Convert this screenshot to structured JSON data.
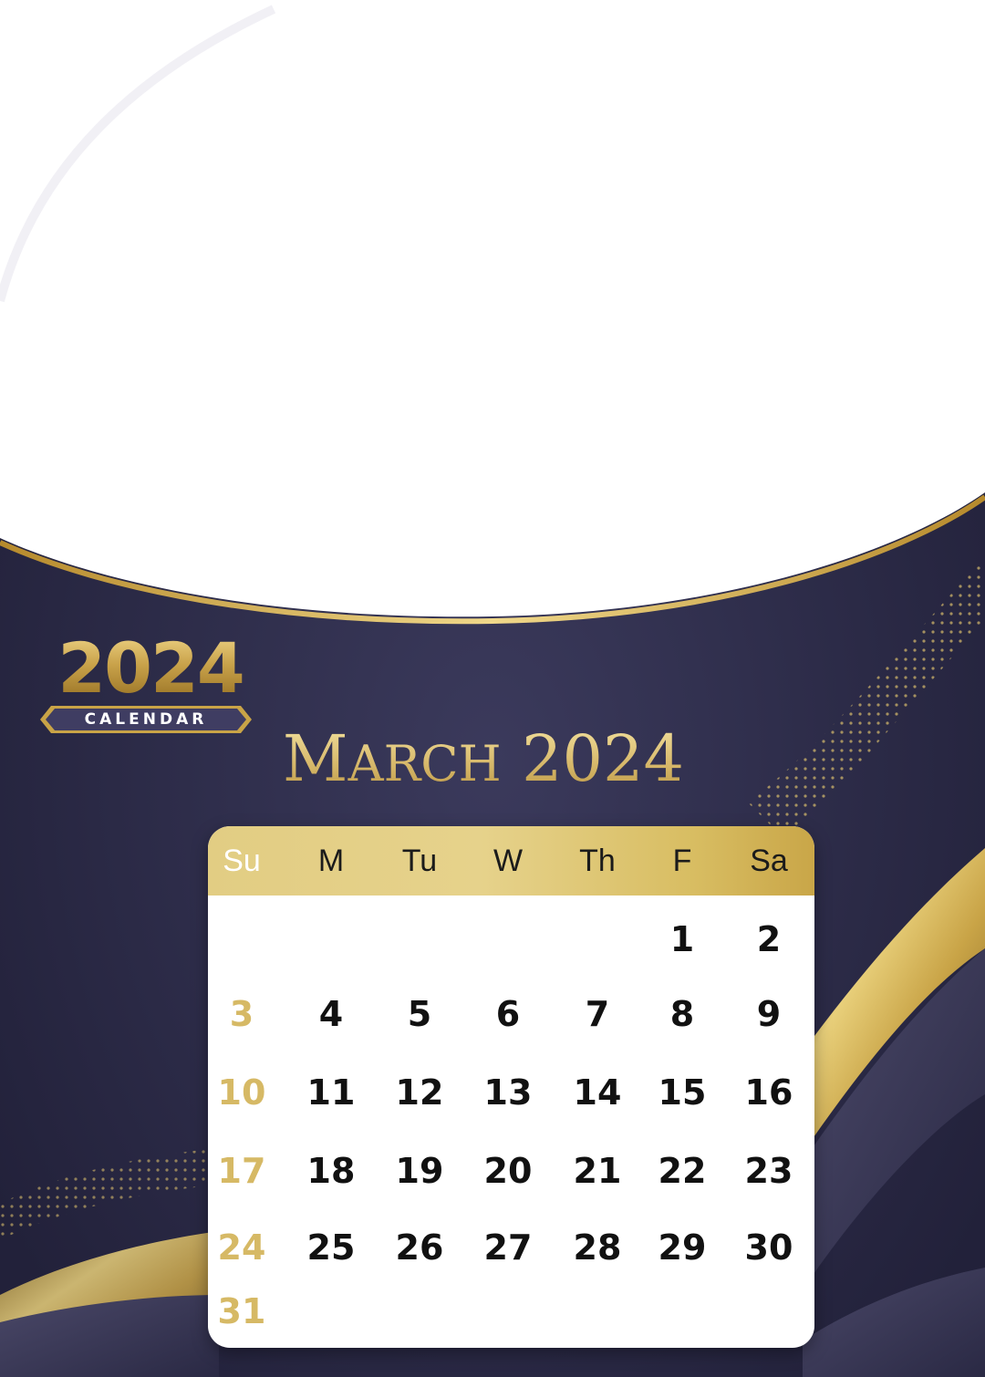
{
  "logo": {
    "year": "2024",
    "ribbon_label": "CALENDAR"
  },
  "title": {
    "month_first": "M",
    "month_rest": "ARCH",
    "year": "2024"
  },
  "weekdays": [
    "Su",
    "M",
    "Tu",
    "W",
    "Th",
    "F",
    "Sa"
  ],
  "weeks": [
    [
      "",
      "",
      "",
      "",
      "",
      "1",
      "2"
    ],
    [
      "3",
      "4",
      "5",
      "6",
      "7",
      "8",
      "9"
    ],
    [
      "10",
      "11",
      "12",
      "13",
      "14",
      "15",
      "16"
    ],
    [
      "17",
      "18",
      "19",
      "20",
      "21",
      "22",
      "23"
    ],
    [
      "24",
      "25",
      "26",
      "27",
      "28",
      "29",
      "30"
    ],
    [
      "31",
      "",
      "",
      "",
      "",
      "",
      ""
    ]
  ],
  "colors": {
    "navy": "#2e2d4c",
    "gold": "#d6b965",
    "header_gold": "#e2cd83",
    "white": "#ffffff"
  }
}
